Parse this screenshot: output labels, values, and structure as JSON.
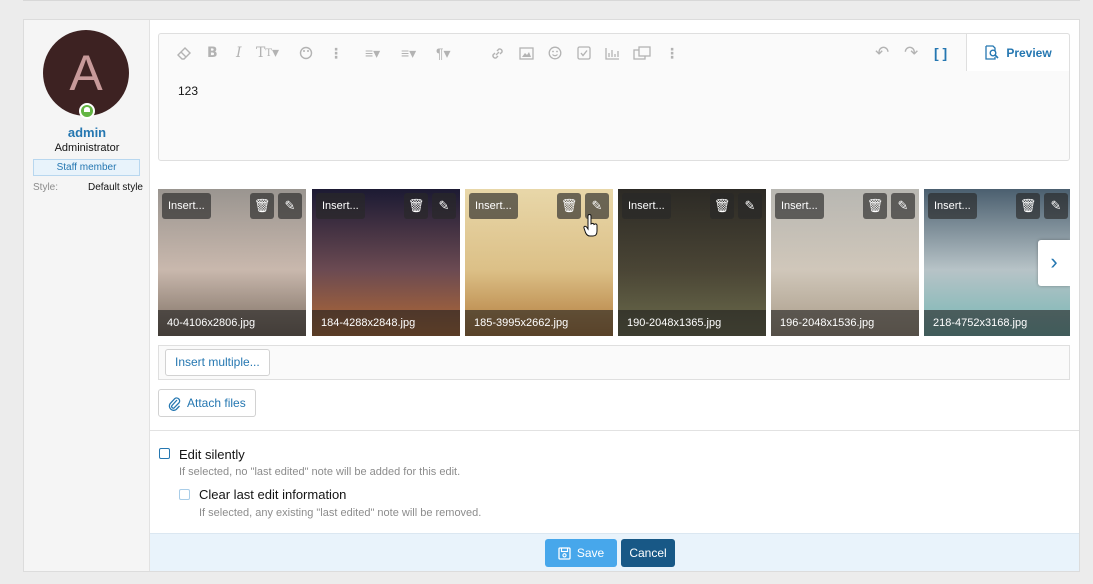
{
  "user": {
    "avatar_letter": "A",
    "name": "admin",
    "title": "Administrator",
    "badge": "Staff member",
    "style_label": "Style:",
    "style_value": "Default style"
  },
  "editor": {
    "content": "123",
    "preview_label": "Preview",
    "toolbar_icons": [
      "eraser-icon",
      "bold-icon",
      "italic-icon",
      "text-size-icon",
      "palette-icon",
      "more-icon",
      "list-icon",
      "align-icon",
      "paragraph-icon",
      "link-icon",
      "image-icon",
      "smilies-icon",
      "checkbox-icon",
      "chart-icon",
      "media-icon",
      "more-icon",
      "undo-icon",
      "redo-icon",
      "bbcode-icon",
      "preview-icon"
    ]
  },
  "attachments": [
    {
      "insert": "Insert...",
      "filename": "40-4106x2806.jpg",
      "colors": [
        "#9a9590",
        "#c9b8ad",
        "#7a6c60"
      ]
    },
    {
      "insert": "Insert...",
      "filename": "184-4288x2848.jpg",
      "colors": [
        "#1c1a33",
        "#6b4a52",
        "#b46a33"
      ]
    },
    {
      "insert": "Insert...",
      "filename": "185-3995x2662.jpg",
      "colors": [
        "#e8d7a9",
        "#dcc087",
        "#b17a3b"
      ]
    },
    {
      "insert": "Insert...",
      "filename": "190-2048x1365.jpg",
      "colors": [
        "#2c2a25",
        "#4a4535",
        "#6c6c4c"
      ]
    },
    {
      "insert": "Insert...",
      "filename": "196-2048x1536.jpg",
      "colors": [
        "#b8b7b2",
        "#d0c7ba",
        "#a89a87"
      ]
    },
    {
      "insert": "Insert...",
      "filename": "218-4752x3168.jpg",
      "colors": [
        "#4b5f6f",
        "#b7c3c7",
        "#74b7b4"
      ]
    }
  ],
  "buttons": {
    "insert_multiple": "Insert multiple...",
    "attach_files": "Attach files",
    "save": "Save",
    "cancel": "Cancel"
  },
  "options": {
    "edit_silently_label": "Edit silently",
    "edit_silently_hint": "If selected, no \"last edited\" note will be added for this edit.",
    "clear_edit_label": "Clear last edit information",
    "clear_edit_hint": "If selected, any existing \"last edited\" note will be removed."
  },
  "colors": {
    "accent": "#2577b1",
    "save_button": "#47a7eb",
    "cancel_button": "#185886",
    "online_status": "#63b543"
  }
}
